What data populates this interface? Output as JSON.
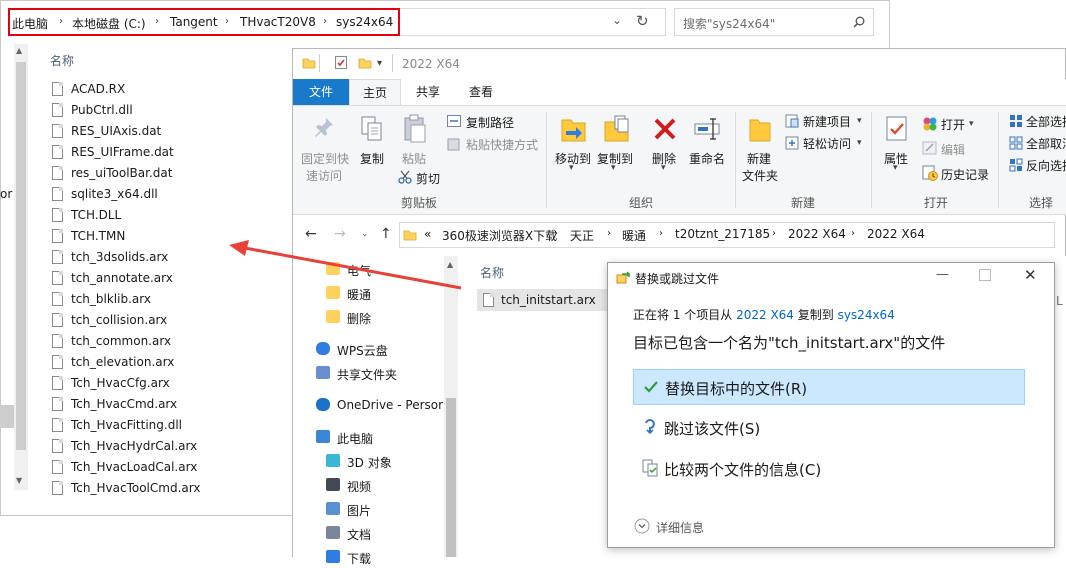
{
  "back_window": {
    "breadcrumbs": [
      "此电脑",
      "本地磁盘 (C:)",
      "Tangent",
      "THvacT20V8",
      "sys24x64"
    ],
    "search_placeholder": "搜索\"sys24x64\"",
    "column_name": "名称",
    "left_fragment": "or",
    "files": [
      "ACAD.RX",
      "PubCtrl.dll",
      "RES_UIAxis.dat",
      "RES_UIFrame.dat",
      "res_uiToolBar.dat",
      "sqlite3_x64.dll",
      "TCH.DLL",
      "TCH.TMN",
      "tch_3dsolids.arx",
      "tch_annotate.arx",
      "tch_blklib.arx",
      "tch_collision.arx",
      "tch_common.arx",
      "tch_elevation.arx",
      "Tch_HvacCfg.arx",
      "Tch_HvacCmd.arx",
      "Tch_HvacFitting.dll",
      "Tch_HvacHydrCal.arx",
      "Tch_HvacLoadCal.arx",
      "Tch_HvacToolCmd.arx"
    ]
  },
  "front_window": {
    "title": "2022 X64",
    "tabs": [
      "文件",
      "主页",
      "共享",
      "查看"
    ],
    "ribbon": {
      "pin_quick_access": "固定到快\n速访问",
      "pin_line1": "固定到快",
      "pin_line2": "速访问",
      "copy": "复制",
      "paste": "粘贴",
      "copy_path": "复制路径",
      "paste_shortcut": "粘贴快捷方式",
      "cut": "剪切",
      "clipboard_group": "剪贴板",
      "move_to": "移动到",
      "copy_to": "复制到",
      "delete": "删除",
      "rename": "重命名",
      "organize_group": "组织",
      "new_folder_line1": "新建",
      "new_folder_line2": "文件夹",
      "new_item": "新建项目",
      "easy_access": "轻松访问",
      "new_group": "新建",
      "properties": "属性",
      "open": "打开",
      "edit": "编辑",
      "history": "历史记录",
      "open_group": "打开",
      "select_all": "全部选择",
      "select_none": "全部取消",
      "invert_selection": "反向选择",
      "select_group": "选择"
    },
    "address": [
      "360极速浏览器X下载",
      "天正",
      "暖通",
      "t20tznt_217185",
      "2022 X64",
      "2022 X64"
    ],
    "address_prefix": "«",
    "nav_items": [
      {
        "label": "电气",
        "icon": "folder-icon"
      },
      {
        "label": "暖通",
        "icon": "folder-icon"
      },
      {
        "label": "删除",
        "icon": "folder-icon"
      },
      {
        "label": "WPS云盘",
        "icon": "cloud-icon"
      },
      {
        "label": "共享文件夹",
        "icon": "shared-folder-icon"
      },
      {
        "label": "OneDrive - Persor",
        "icon": "onedrive-icon"
      },
      {
        "label": "此电脑",
        "icon": "computer-icon"
      },
      {
        "label": "3D 对象",
        "icon": "cube-icon"
      },
      {
        "label": "视频",
        "icon": "video-icon"
      },
      {
        "label": "图片",
        "icon": "picture-icon"
      },
      {
        "label": "文档",
        "icon": "document-icon"
      },
      {
        "label": "下载",
        "icon": "download-icon"
      }
    ],
    "column_name": "名称",
    "files": [
      "tch_initstart.arx"
    ],
    "right_edge_fragment": "L"
  },
  "dialog": {
    "title": "替换或跳过文件",
    "line1_prefix": "正在将 1 个项目从 ",
    "line1_source": "2022 X64",
    "line1_middle": " 复制到 ",
    "line1_dest": "sys24x64",
    "heading": "目标已包含一个名为\"tch_initstart.arx\"的文件",
    "options": [
      "替换目标中的文件(R)",
      "跳过该文件(S)",
      "比较两个文件的信息(C)"
    ],
    "details": "详细信息"
  },
  "colors": {
    "accent": "#1979ca",
    "file_tab": "#1979ca",
    "highlight_border": "#e60012",
    "arrow": "#e8413a",
    "option_selected_bg": "#cce8ff",
    "option_selected_border": "#99d1ff",
    "link": "#0066cc",
    "check": "#2e9d3a"
  }
}
